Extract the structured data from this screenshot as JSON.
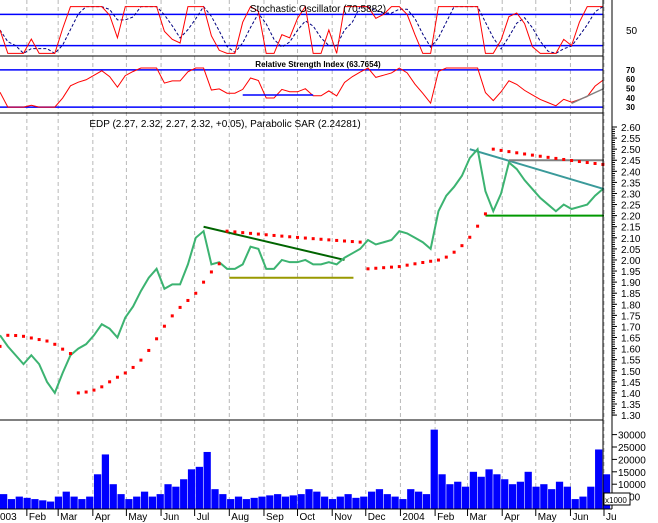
{
  "chart_data": [
    {
      "type": "line",
      "title": "Stochastic Oscillator (70.5882)",
      "yticks": [
        "50"
      ],
      "levels": [
        80,
        20
      ],
      "ylim": [
        0,
        100
      ],
      "series_colors": {
        "k": "#ff0000",
        "d": "#000080"
      }
    },
    {
      "type": "line",
      "title": "Relative Strength Index (63.7654)",
      "yticks": [
        "70",
        "60",
        "50",
        "40",
        "30"
      ],
      "levels": [
        70,
        30
      ],
      "ylim": [
        30,
        70
      ],
      "annotations": [
        {
          "type": "line",
          "color": "#0000ff",
          "from": [
            "2003-08-13",
            43
          ],
          "to": [
            "2003-10-15",
            43
          ]
        },
        {
          "type": "line",
          "color": "#808080",
          "from": [
            "2004-06-02",
            34
          ],
          "to": [
            "2004-07-01",
            50
          ]
        }
      ]
    },
    {
      "type": "line",
      "title": "EDP (2.27, 2.32, 2.27, 2.32, +0.05), Parabolic SAR (2.24281)",
      "ylim": [
        1.3,
        2.6
      ],
      "yticks": [
        "2.60",
        "2.55",
        "2.50",
        "2.45",
        "2.40",
        "2.35",
        "2.30",
        "2.25",
        "2.20",
        "2.15",
        "2.10",
        "2.05",
        "2.00",
        "1.95",
        "1.90",
        "1.85",
        "1.80",
        "1.75",
        "1.70",
        "1.65",
        "1.60",
        "1.55",
        "1.50",
        "1.45",
        "1.40",
        "1.35",
        "1.30"
      ],
      "price_color": "#3cb371",
      "sar_color": "#ff0000",
      "dates": [
        "2003-01-08",
        "2003-01-15",
        "2003-01-22",
        "2003-01-29",
        "2003-02-05",
        "2003-02-12",
        "2003-02-19",
        "2003-02-26",
        "2003-03-05",
        "2003-03-12",
        "2003-03-19",
        "2003-03-26",
        "2003-04-02",
        "2003-04-09",
        "2003-04-16",
        "2003-04-23",
        "2003-04-30",
        "2003-05-07",
        "2003-05-14",
        "2003-05-21",
        "2003-05-28",
        "2003-06-04",
        "2003-06-11",
        "2003-06-18",
        "2003-06-25",
        "2003-07-02",
        "2003-07-09",
        "2003-07-16",
        "2003-07-23",
        "2003-07-30",
        "2003-08-06",
        "2003-08-13",
        "2003-08-20",
        "2003-08-27",
        "2003-09-03",
        "2003-09-10",
        "2003-09-17",
        "2003-09-24",
        "2003-10-01",
        "2003-10-08",
        "2003-10-15",
        "2003-10-22",
        "2003-10-29",
        "2003-11-05",
        "2003-11-12",
        "2003-11-19",
        "2003-11-26",
        "2003-12-03",
        "2003-12-10",
        "2003-12-17",
        "2003-12-24",
        "2003-12-31",
        "2004-01-07",
        "2004-01-14",
        "2004-01-21",
        "2004-01-28",
        "2004-02-04",
        "2004-02-11",
        "2004-02-18",
        "2004-02-25",
        "2004-03-03",
        "2004-03-10",
        "2004-03-17",
        "2004-03-24",
        "2004-03-31",
        "2004-04-07",
        "2004-04-14",
        "2004-04-21",
        "2004-04-28",
        "2004-05-05",
        "2004-05-12",
        "2004-05-19",
        "2004-05-26",
        "2004-06-02",
        "2004-06-09",
        "2004-06-16",
        "2004-06-23",
        "2004-06-30"
      ],
      "close": [
        1.66,
        1.61,
        1.57,
        1.53,
        1.57,
        1.53,
        1.45,
        1.4,
        1.49,
        1.57,
        1.6,
        1.62,
        1.66,
        1.71,
        1.69,
        1.65,
        1.74,
        1.79,
        1.86,
        1.92,
        1.96,
        1.87,
        1.89,
        1.89,
        1.98,
        2.1,
        2.13,
        1.98,
        1.99,
        1.96,
        1.96,
        1.98,
        2.06,
        2.05,
        1.96,
        1.96,
        2.0,
        1.99,
        1.99,
        2.0,
        1.98,
        1.98,
        1.99,
        1.98,
        2.01,
        2.03,
        2.05,
        2.09,
        2.07,
        2.08,
        2.09,
        2.13,
        2.12,
        2.1,
        2.08,
        2.05,
        2.22,
        2.29,
        2.33,
        2.38,
        2.46,
        2.5,
        2.31,
        2.22,
        2.3,
        2.44,
        2.41,
        2.36,
        2.32,
        2.28,
        2.25,
        2.22,
        2.25,
        2.23,
        2.24,
        2.25,
        2.29,
        2.32
      ],
      "annotations": [
        {
          "type": "line",
          "color": "#006400",
          "from": [
            "2003-07-09",
            2.15
          ],
          "to": [
            "2003-11-12",
            2.0
          ]
        },
        {
          "type": "line",
          "color": "#999900",
          "from": [
            "2003-08-01",
            1.92
          ],
          "to": [
            "2003-11-20",
            1.92
          ]
        },
        {
          "type": "line",
          "color": "#3a9a9a",
          "from": [
            "2004-03-03",
            2.5
          ],
          "to": [
            "2004-07-01",
            2.32
          ]
        },
        {
          "type": "line",
          "color": "#009900",
          "from": [
            "2004-03-17",
            2.2
          ],
          "to": [
            "2004-07-01",
            2.2
          ]
        },
        {
          "type": "line",
          "color": "#808080",
          "from": [
            "2004-04-07",
            2.45
          ],
          "to": [
            "2004-07-01",
            2.45
          ]
        }
      ]
    },
    {
      "type": "bar",
      "unit_label": "x1000",
      "yticks": [
        "30000",
        "25000",
        "20000",
        "15000",
        "10000",
        "5000"
      ],
      "ylim": [
        0,
        33000
      ],
      "color": "#0000ff",
      "values": [
        6000,
        4000,
        5000,
        4500,
        4000,
        3500,
        3000,
        5000,
        7000,
        5000,
        4000,
        5000,
        14000,
        22000,
        10000,
        6000,
        4000,
        5000,
        7000,
        5000,
        6000,
        10000,
        9000,
        12000,
        16000,
        17000,
        23000,
        8000,
        6000,
        4000,
        5000,
        4000,
        4500,
        5000,
        5500,
        6000,
        5000,
        5500,
        6000,
        8000,
        7000,
        5000,
        4000,
        5000,
        6000,
        4500,
        5000,
        7000,
        8000,
        6000,
        5000,
        4000,
        8000,
        7000,
        6000,
        32000,
        14000,
        10000,
        11000,
        9000,
        15000,
        13000,
        16000,
        14000,
        12000,
        10000,
        11000,
        15000,
        9000,
        10000,
        8000,
        11000,
        9000,
        4000,
        5000,
        9000,
        24000,
        14000
      ]
    }
  ],
  "x_axis": {
    "first_label": "003",
    "months": [
      {
        "date": "2003-02-01",
        "label": "Feb"
      },
      {
        "date": "2003-03-01",
        "label": "Mar"
      },
      {
        "date": "2003-04-01",
        "label": "Apr"
      },
      {
        "date": "2003-05-01",
        "label": "May"
      },
      {
        "date": "2003-06-01",
        "label": "Jun"
      },
      {
        "date": "2003-07-01",
        "label": "Jul"
      },
      {
        "date": "2003-08-01",
        "label": "Aug"
      },
      {
        "date": "2003-09-01",
        "label": "Sep"
      },
      {
        "date": "2003-10-01",
        "label": "Oct"
      },
      {
        "date": "2003-11-01",
        "label": "Nov"
      },
      {
        "date": "2003-12-01",
        "label": "Dec"
      },
      {
        "date": "2004-01-01",
        "label": "2004"
      },
      {
        "date": "2004-02-01",
        "label": "Feb"
      },
      {
        "date": "2004-03-01",
        "label": "Mar"
      },
      {
        "date": "2004-04-01",
        "label": "Apr"
      },
      {
        "date": "2004-05-01",
        "label": "May"
      },
      {
        "date": "2004-06-01",
        "label": "Jun"
      },
      {
        "date": "2004-07-01",
        "label": "Ju"
      }
    ]
  }
}
